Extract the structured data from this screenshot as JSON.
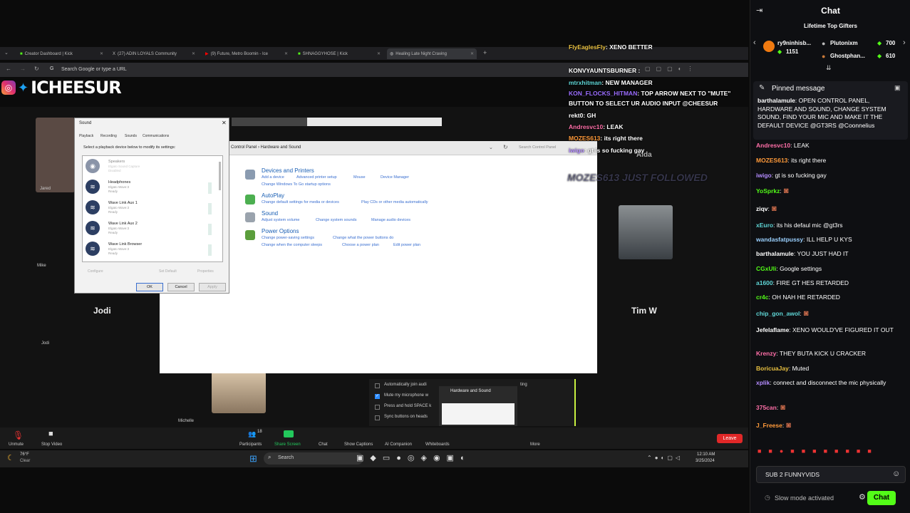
{
  "browser": {
    "tabs": [
      {
        "label": "Creator Dashboard | Kick"
      },
      {
        "label": "(27) ADIN LOYALS Community"
      },
      {
        "label": "(9) Future, Metro Boomin - Ice"
      },
      {
        "label": "SHNAGGYHOSE | Kick"
      },
      {
        "label": "Healing Late Night Craving"
      }
    ],
    "address_placeholder": "Search Google or type a URL"
  },
  "streamer_tag": "ICHEESUR",
  "participants": {
    "jodi": "Jodi",
    "timw": "Tim W",
    "jared": "Jared",
    "mike": "Mike",
    "michelle": "Michelle",
    "aida": "Aida"
  },
  "sound_dialog": {
    "title": "Sound",
    "tabs": [
      "Playback",
      "Recording",
      "Sounds",
      "Communications"
    ],
    "instruction": "Select a playback device below to modify its settings:",
    "devices": [
      {
        "name": "Speakers",
        "sub": "Elgato Sound Capture",
        "status": "Disabled"
      },
      {
        "name": "Headphones",
        "sub": "Elgato Wave:3",
        "status": "Ready"
      },
      {
        "name": "Wave Link Aux 1",
        "sub": "Elgato Wave:3",
        "status": "Ready"
      },
      {
        "name": "Wave Link Aux 2",
        "sub": "Elgato Wave:3",
        "status": "Ready"
      },
      {
        "name": "Wave Link Browser",
        "sub": "Elgato Wave:3",
        "status": "Ready"
      }
    ],
    "configure": "Configure",
    "set_default": "Set Default",
    "properties": "Properties",
    "ok": "OK",
    "cancel": "Cancel",
    "apply": "Apply"
  },
  "control_panel": {
    "breadcrumb": "Control Panel  ›  Hardware and Sound",
    "search_placeholder": "Search Control Panel",
    "sections": [
      {
        "heading": "Devices and Printers",
        "links": [
          "Add a device",
          "Advanced printer setup",
          "Mouse",
          "Device Manager",
          "Change Windows To Go startup options"
        ]
      },
      {
        "heading": "AutoPlay",
        "links": [
          "Change default settings for media or devices",
          "Play CDs or other media automatically"
        ]
      },
      {
        "heading": "Sound",
        "links": [
          "Adjust system volume",
          "Change system sounds",
          "Manage audio devices"
        ]
      },
      {
        "heading": "Power Options",
        "links": [
          "Change power-saving settings",
          "Change what the power buttons do",
          "Change when the computer sleeps",
          "Choose a power plan",
          "Edit power plan"
        ]
      }
    ]
  },
  "zoom_options": {
    "o1": "Automatically join audi",
    "o2": "Mute my microphone w",
    "o3": "Press and hold SPACE k",
    "o4": "Sync buttons on heads",
    "popup_title": "Hardware and Sound",
    "trailing": "ting"
  },
  "zoom_toolbar": {
    "unmute": "Unmute",
    "stop_video": "Stop Video",
    "participants": "Participants",
    "participants_count": "18",
    "share_screen": "Share Screen",
    "chat": "Chat",
    "show_captions": "Show Captions",
    "ai_companion": "AI Companion",
    "whiteboards": "Whiteboards",
    "more": "More",
    "leave": "Leave"
  },
  "taskbar": {
    "weather_temp": "76°F",
    "weather_desc": "Clear",
    "search": "Search",
    "time": "12:10 AM",
    "date": "3/25/2024"
  },
  "overlay_chat": [
    {
      "user": "FlyEaglesFly",
      "text": ": XENO BETTER",
      "color": "#e8c040"
    },
    {
      "user": "KONVYAUNTSBURNER",
      "text": " :",
      "color": "#ffffff"
    },
    {
      "user": "mtrxhitman",
      "text": ": NEW MANAGER",
      "color": "#5fd6d6"
    },
    {
      "user": "KON_FLOCKS_HITMAN",
      "text": ": TOP ARROW NEXT TO \"MUTE\"",
      "color": "#9b6dff"
    },
    {
      "user": "",
      "text": "BUTTON TO SELECT UR AUDIO INPUT @CHEESUR",
      "color": "#ffffff"
    },
    {
      "user": "rekt0",
      "text": ": GH",
      "color": "#ffffff"
    },
    {
      "user": "Andresvc10",
      "text": ": LEAK",
      "color": "#ff6fa8"
    },
    {
      "user": "MOZES613",
      "text": ": its right there",
      "color": "#ff9a3a"
    },
    {
      "user": "iwigo",
      "text": ": gt is so fucking gay",
      "color": "#b48cff"
    }
  ],
  "follow_alert": "MOZES613 JUST FOLLOWED",
  "chat_panel": {
    "title": "Chat",
    "gifters_title": "Lifetime Top Gifters",
    "gifters": [
      {
        "name": "ry9ninhisb...",
        "count": "1151"
      },
      {
        "name": "Plutonixm",
        "count": "700"
      },
      {
        "name": "Ghostphan...",
        "count": "610"
      }
    ],
    "pinned_title": "Pinned message",
    "pinned": {
      "user": "barthalamule",
      "text": ": OPEN CONTROL PANEL, HARDWARE AND SOUND, CHANGE SYSTEM SOUND, FIND YOUR MIC AND MAKE IT THE DEFAULT DEVICE @GT3RS @Coonnelius"
    },
    "messages": [
      {
        "user": "Andresvc10",
        "text": ": LEAK",
        "color": "#ff6fa8"
      },
      {
        "user": "MOZES613",
        "text": ": its right there",
        "color": "#ff9a3a"
      },
      {
        "user": "iwigo",
        "text": ": gt is so fucking gay",
        "color": "#b48cff"
      },
      {
        "user": "YoSprkz",
        "text": ":",
        "color": "#53fc18"
      },
      {
        "user": "ziqv",
        "text": ":",
        "color": "#ffffff"
      },
      {
        "user": "xEuro",
        "text": ": its his defaul mic @gt3rs",
        "color": "#5fd6d6"
      },
      {
        "user": "wandasfatpussy",
        "text": ": ILL HELP U KYS",
        "color": "#9ad0ff"
      },
      {
        "user": "barthalamule",
        "text": ": YOU JUST HAD IT",
        "color": "#ffffff"
      },
      {
        "user": "CGxUli",
        "text": ": Google settings",
        "color": "#53fc18"
      },
      {
        "user": "a1600",
        "text": ": FIRE GT HES RETARDED",
        "color": "#5fd6d6"
      },
      {
        "user": "cr4c",
        "text": ": OH NAH HE RETARDED",
        "color": "#53fc18"
      },
      {
        "user": "chip_gon_awol",
        "text": ":",
        "color": "#5fd6d6"
      },
      {
        "user": "Jefelaflame",
        "text": ": XENO WOULD'VE FIGURED IT OUT",
        "color": "#ffffff"
      },
      {
        "user": "Krenzy",
        "text": ": THEY BUTA KICK U CRACKER",
        "color": "#ff6fa8"
      },
      {
        "user": "BoricuaJay",
        "text": ": Muted",
        "color": "#e8c040"
      },
      {
        "user": "xplik",
        "text": ": connect and disconnect the mic physically",
        "color": "#b48cff"
      },
      {
        "user": "375can",
        "text": ":",
        "color": "#ff6fa8"
      },
      {
        "user": "J_Freese",
        "text": ":",
        "color": "#ff9a3a"
      }
    ],
    "input_value": "SUB 2 FUNNYVIDS",
    "slow_mode": "Slow mode activated",
    "send_label": "Chat"
  },
  "colors": {
    "kick_green": "#53fc18",
    "chat_bg": "#0e0f12",
    "link_blue": "#3a6fd0"
  }
}
